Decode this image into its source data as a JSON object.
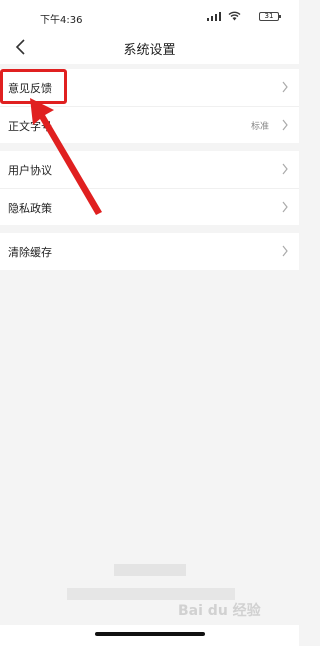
{
  "status": {
    "time": "下午4:36",
    "battery": "31"
  },
  "nav": {
    "title": "系统设置",
    "back_icon": "chevron-left-icon"
  },
  "groups": [
    {
      "items": [
        {
          "label": "意见反馈",
          "value": ""
        },
        {
          "label": "正文字号",
          "value": "标准"
        }
      ]
    },
    {
      "items": [
        {
          "label": "用户协议",
          "value": ""
        },
        {
          "label": "隐私政策",
          "value": ""
        }
      ]
    },
    {
      "items": [
        {
          "label": "清除缓存",
          "value": ""
        }
      ]
    }
  ],
  "watermark": "Bai du 经验",
  "colors": {
    "highlight": "#e02020",
    "background": "#f4f4f4",
    "panel": "#ffffff"
  }
}
